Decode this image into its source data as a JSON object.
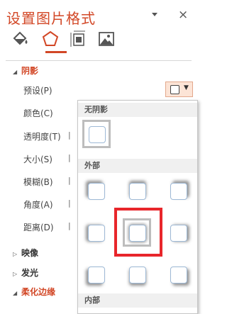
{
  "pane": {
    "title": "设置图片格式",
    "pin_icon": "pin-dropdown-icon",
    "close_label": "×"
  },
  "tabs": [
    {
      "name": "fill-line",
      "icon": "paint-bucket-icon"
    },
    {
      "name": "effects",
      "icon": "pentagon-icon",
      "active": true
    },
    {
      "name": "size-properties",
      "icon": "size-properties-icon"
    },
    {
      "name": "picture",
      "icon": "picture-icon"
    }
  ],
  "sections": {
    "shadow": {
      "label": "阴影",
      "expanded": true
    },
    "reflection": {
      "label": "映像",
      "expanded": false
    },
    "glow": {
      "label": "发光",
      "expanded": false
    },
    "soft_edges": {
      "label": "柔化边缘",
      "expanded": true
    }
  },
  "shadow_props": {
    "preset": "预设(P)",
    "color": "颜色(C)",
    "transparency": "透明度(T)",
    "size": "大小(S)",
    "blur": "模糊(B)",
    "angle": "角度(A)",
    "distance": "距离(D)"
  },
  "gallery": {
    "no_shadow_header": "无阴影",
    "outer_header": "外部",
    "inner_header": "内部",
    "selected_outer": "center"
  },
  "colors": {
    "accent": "#d24726",
    "highlight": "#e8262b",
    "preset_bg": "#fce4d6"
  }
}
